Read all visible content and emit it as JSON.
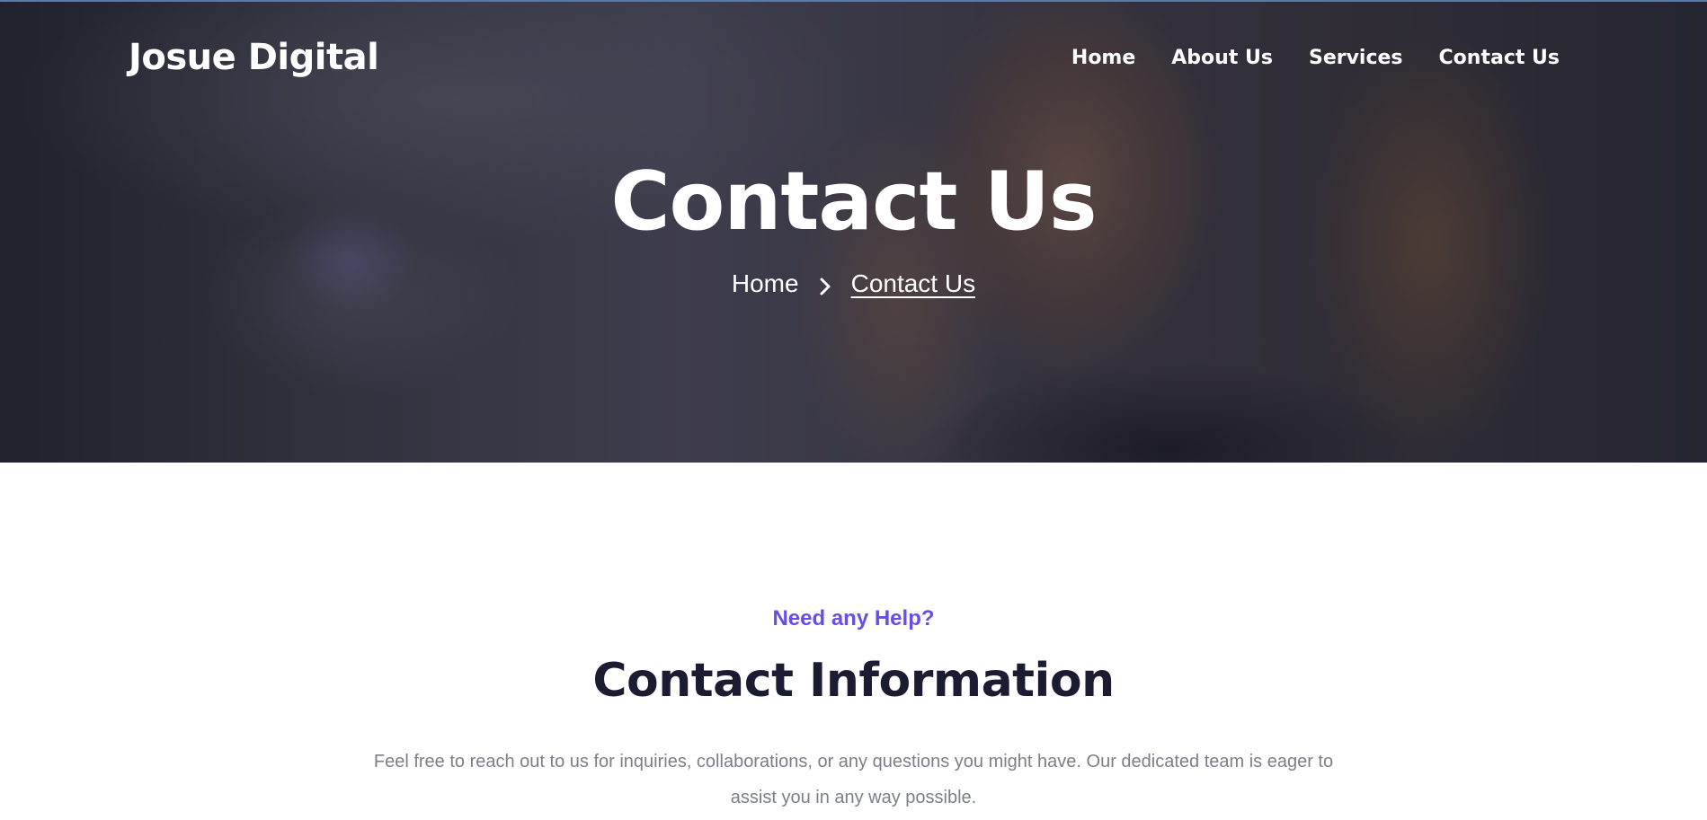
{
  "brand": {
    "name": "Josue Digital"
  },
  "nav": {
    "items": [
      {
        "label": "Home"
      },
      {
        "label": "About Us"
      },
      {
        "label": "Services"
      },
      {
        "label": "Contact Us"
      }
    ]
  },
  "hero": {
    "title": "Contact Us",
    "breadcrumb": {
      "home": "Home",
      "separator_icon": "chevron-right-icon",
      "current": "Contact Us"
    }
  },
  "contact": {
    "eyebrow": "Need any Help?",
    "title": "Contact Information",
    "description": "Feel free to reach out to us for inquiries, collaborations, or any questions you might have. Our dedicated team is eager to assist you in any way possible."
  },
  "colors": {
    "accent": "#6a4de6",
    "heading": "#1b1c31",
    "body_text": "#7b7f8c",
    "hero_text": "#ffffff"
  }
}
